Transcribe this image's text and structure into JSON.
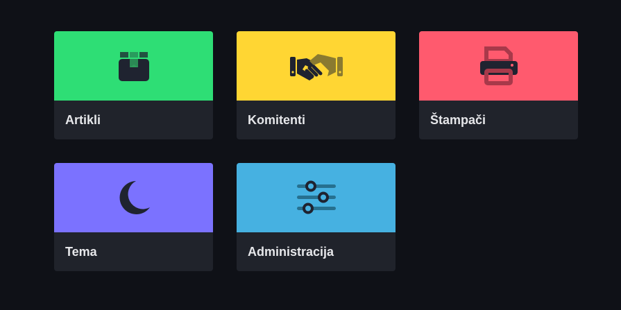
{
  "tiles": [
    {
      "label": "Artikli",
      "icon": "box-icon",
      "color": "#2ede75"
    },
    {
      "label": "Komitenti",
      "icon": "handshake-icon",
      "color": "#ffd633"
    },
    {
      "label": "Štampači",
      "icon": "printer-icon",
      "color": "#ff5a6e"
    },
    {
      "label": "Tema",
      "icon": "moon-icon",
      "color": "#7b72ff"
    },
    {
      "label": "Administracija",
      "icon": "sliders-icon",
      "color": "#46b1e1"
    }
  ],
  "icon_color": "#1f2330"
}
